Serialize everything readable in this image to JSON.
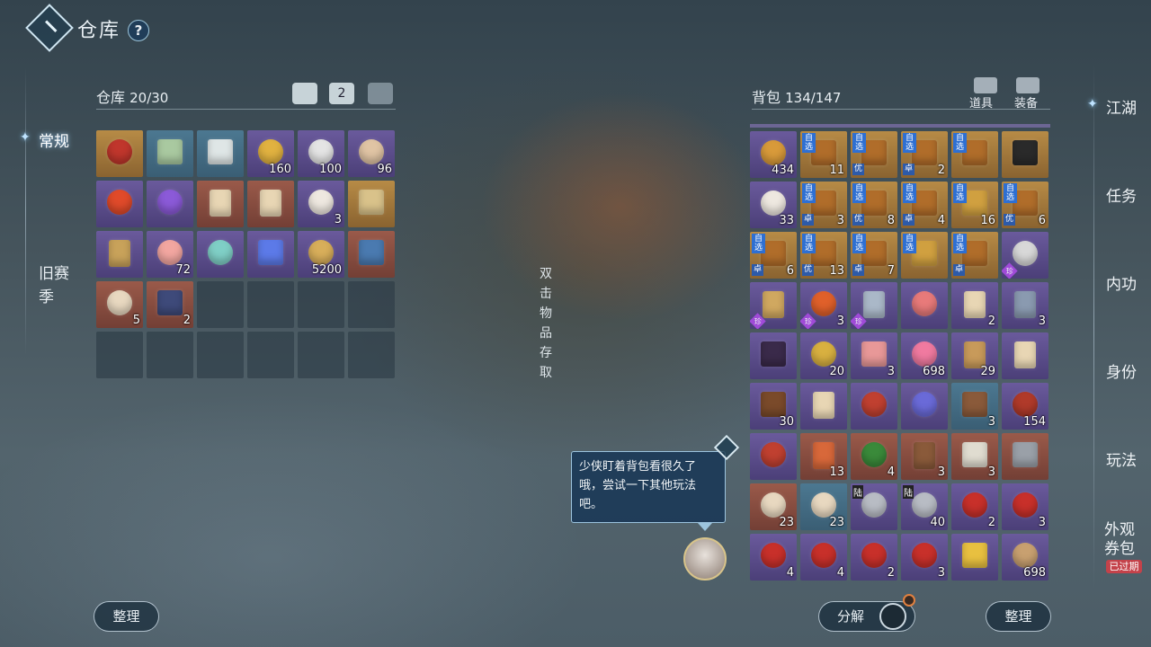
{
  "header": {
    "title": "仓库",
    "help": "?"
  },
  "left_tabs": [
    {
      "label": "常规",
      "active": true
    },
    {
      "label": "旧赛\n季",
      "active": false
    }
  ],
  "warehouse": {
    "label": "仓库",
    "count": "20/30",
    "sort_label": "整理",
    "tab2_number": "2"
  },
  "hint_vertical": "双击物品存取",
  "bag": {
    "label": "背包",
    "count": "134/147",
    "filter_prop": "道具",
    "filter_equip": "装备",
    "decompose_label": "分解",
    "sort_label": "整理"
  },
  "tip": "少侠盯着背包看很久了哦，尝试一下其他玩法吧。",
  "right_tabs": [
    "江湖",
    "任务",
    "内功",
    "身份",
    "玩法",
    "外观\n券包"
  ],
  "expired_badge": "已过期",
  "warehouse_items": [
    {
      "icon": "red-lantern-icon",
      "q": "gold",
      "color": "#c0362c",
      "shape": "round",
      "count": ""
    },
    {
      "icon": "jade-teapot-icon",
      "q": "blue",
      "color": "#a9c9a0",
      "shape": "box",
      "count": ""
    },
    {
      "icon": "porcelain-vase-icon",
      "q": "blue",
      "color": "#dfe6e6",
      "shape": "box",
      "count": ""
    },
    {
      "icon": "gold-coin-icon",
      "q": "purple",
      "color": "#e1b240",
      "shape": "round",
      "count": "160"
    },
    {
      "icon": "silver-ingot-icon",
      "q": "purple",
      "color": "#e4e4e4",
      "shape": "round",
      "count": "100"
    },
    {
      "icon": "pig-mask-icon",
      "q": "purple",
      "color": "#e0c4a4",
      "shape": "round",
      "count": "96"
    },
    {
      "icon": "fire-orb-icon",
      "q": "purple",
      "color": "#e04a2a",
      "shape": "round",
      "count": ""
    },
    {
      "icon": "purple-spirit-icon",
      "q": "purple",
      "color": "#8b5ad8",
      "shape": "round",
      "count": ""
    },
    {
      "icon": "scroll-icon",
      "q": "red",
      "color": "#e8d6b4",
      "shape": "scroll",
      "count": ""
    },
    {
      "icon": "scroll-icon",
      "q": "red",
      "color": "#e8d6b4",
      "shape": "scroll",
      "count": ""
    },
    {
      "icon": "gourd-icon",
      "q": "purple",
      "color": "#eee8e0",
      "shape": "round",
      "count": "3"
    },
    {
      "icon": "letter-icon",
      "q": "gold",
      "color": "#d9c28a",
      "shape": "box",
      "count": ""
    },
    {
      "icon": "bamboo-scroll-icon",
      "q": "purple",
      "color": "#c8a25a",
      "shape": "scroll",
      "count": ""
    },
    {
      "icon": "pink-star-icon",
      "q": "purple",
      "color": "#f2a6a0",
      "shape": "round",
      "count": "72"
    },
    {
      "icon": "jade-hook-icon",
      "q": "purple",
      "color": "#7fcfc6",
      "shape": "round",
      "count": ""
    },
    {
      "icon": "ticket-icon",
      "q": "purple",
      "color": "#5c7ae8",
      "shape": "box",
      "count": ""
    },
    {
      "icon": "golden-figure-icon",
      "q": "purple",
      "color": "#d8ae5a",
      "shape": "round",
      "count": "5200"
    },
    {
      "icon": "jar-icon",
      "q": "red",
      "color": "#4a7ab0",
      "shape": "box",
      "count": ""
    },
    {
      "icon": "rice-bowl-icon",
      "q": "red",
      "color": "#e8d8c0",
      "shape": "round",
      "count": "5"
    },
    {
      "icon": "book-icon",
      "q": "red",
      "color": "#3e4a7a",
      "shape": "box",
      "count": "2"
    }
  ],
  "bag_items": [
    {
      "icon": "gold-leaf-icon",
      "q": "purple",
      "color": "#d89a3a",
      "shape": "round",
      "count": "434"
    },
    {
      "icon": "chest-icon",
      "q": "gold",
      "color": "#b06d2a",
      "shape": "box",
      "count": "11",
      "tag": "自选"
    },
    {
      "icon": "chest-icon",
      "q": "gold",
      "color": "#b06d2a",
      "shape": "box",
      "count": "",
      "tag": "自选",
      "tag2": "优"
    },
    {
      "icon": "chest-icon",
      "q": "gold",
      "color": "#b06d2a",
      "shape": "box",
      "count": "2",
      "tag": "自选",
      "tag2": "卓"
    },
    {
      "icon": "chest-icon",
      "q": "gold",
      "color": "#b06d2a",
      "shape": "box",
      "count": "",
      "tag": "自选"
    },
    {
      "icon": "black-chest-icon",
      "q": "gold",
      "color": "#2a2a2a",
      "shape": "box",
      "count": ""
    },
    {
      "icon": "gourd-icon",
      "q": "purple",
      "color": "#eee8e0",
      "shape": "round",
      "count": "33"
    },
    {
      "icon": "chest-icon",
      "q": "gold",
      "color": "#b06d2a",
      "shape": "box",
      "count": "3",
      "tag": "自选",
      "tag2": "卓"
    },
    {
      "icon": "chest-icon",
      "q": "gold",
      "color": "#b06d2a",
      "shape": "box",
      "count": "8",
      "tag": "自选",
      "tag2": "优"
    },
    {
      "icon": "chest-icon",
      "q": "gold",
      "color": "#b06d2a",
      "shape": "box",
      "count": "4",
      "tag": "自选",
      "tag2": "卓"
    },
    {
      "icon": "chest-icon",
      "q": "gold",
      "color": "#d0a040",
      "shape": "box",
      "count": "16",
      "tag": "自选"
    },
    {
      "icon": "chest-icon",
      "q": "gold",
      "color": "#b06d2a",
      "shape": "box",
      "count": "6",
      "tag": "自选",
      "tag2": "优"
    },
    {
      "icon": "chest-icon",
      "q": "gold",
      "color": "#b06d2a",
      "shape": "box",
      "count": "6",
      "tag": "自选",
      "tag2": "卓"
    },
    {
      "icon": "chest-icon",
      "q": "gold",
      "color": "#b06d2a",
      "shape": "box",
      "count": "13",
      "tag": "自选",
      "tag2": "优"
    },
    {
      "icon": "chest-icon",
      "q": "gold",
      "color": "#b06d2a",
      "shape": "box",
      "count": "7",
      "tag": "自选",
      "tag2": "卓"
    },
    {
      "icon": "chest-icon",
      "q": "gold",
      "color": "#d0a040",
      "shape": "box",
      "count": "",
      "tag": "自选"
    },
    {
      "icon": "chest-icon",
      "q": "gold",
      "color": "#b06d2a",
      "shape": "box",
      "count": "",
      "tag": "自选",
      "tag2": "卓"
    },
    {
      "icon": "silver-mask-icon",
      "q": "purple",
      "color": "#d8d8d8",
      "shape": "round",
      "count": "",
      "zhen": "珍"
    },
    {
      "icon": "map-scroll-icon",
      "q": "purple",
      "color": "#d0a860",
      "shape": "scroll",
      "count": "",
      "zhen": "珍"
    },
    {
      "icon": "flame-icon",
      "q": "purple",
      "color": "#e0602a",
      "shape": "round",
      "count": "3",
      "zhen": "珍"
    },
    {
      "icon": "sword-icon",
      "q": "purple",
      "color": "#aab8c8",
      "shape": "scroll",
      "count": "",
      "zhen": "珍"
    },
    {
      "icon": "crystal-ball-icon",
      "q": "purple",
      "color": "#e87a7a",
      "shape": "round",
      "count": ""
    },
    {
      "icon": "scroll-icon",
      "q": "purple",
      "color": "#e8d6b4",
      "shape": "scroll",
      "count": "2"
    },
    {
      "icon": "spear-icon",
      "q": "purple",
      "color": "#8a9ab0",
      "shape": "scroll",
      "count": "3"
    },
    {
      "icon": "dark-chest-icon",
      "q": "purple",
      "color": "#3a2a4a",
      "shape": "box",
      "count": ""
    },
    {
      "icon": "gold-medal-icon",
      "q": "purple",
      "color": "#d8b040",
      "shape": "round",
      "count": "20"
    },
    {
      "icon": "red-envelope-icon",
      "q": "purple",
      "color": "#e89898",
      "shape": "box",
      "count": "3"
    },
    {
      "icon": "pink-orb-icon",
      "q": "purple",
      "color": "#f07aa0",
      "shape": "round",
      "count": "698"
    },
    {
      "icon": "pendant-icon",
      "q": "purple",
      "color": "#c89a5a",
      "shape": "scroll",
      "count": "29"
    },
    {
      "icon": "scroll-icon",
      "q": "purple",
      "color": "#e8d6b4",
      "shape": "scroll",
      "count": ""
    },
    {
      "icon": "treasure-chest-icon",
      "q": "purple",
      "color": "#7a4a2a",
      "shape": "box",
      "count": "30"
    },
    {
      "icon": "scroll-icon",
      "q": "purple",
      "color": "#e8d6b4",
      "shape": "scroll",
      "count": ""
    },
    {
      "icon": "lucky-bag-icon",
      "q": "purple",
      "color": "#c04030",
      "shape": "round",
      "count": ""
    },
    {
      "icon": "mystic-orb-icon",
      "q": "purple",
      "color": "#6a6ad8",
      "shape": "round",
      "count": ""
    },
    {
      "icon": "arrows-bundle-icon",
      "q": "blue",
      "color": "#8a5a3a",
      "shape": "box",
      "count": "3"
    },
    {
      "icon": "lantern-bag-icon",
      "q": "purple",
      "color": "#b03a2a",
      "shape": "round",
      "count": "154"
    },
    {
      "icon": "lucky-bag-icon",
      "q": "purple",
      "color": "#c04030",
      "shape": "round",
      "count": ""
    },
    {
      "icon": "talisman-icon",
      "q": "red",
      "color": "#d8683a",
      "shape": "scroll",
      "count": "13"
    },
    {
      "icon": "holly-icon",
      "q": "red",
      "color": "#3a8a3a",
      "shape": "round",
      "count": "4"
    },
    {
      "icon": "wooden-staff-icon",
      "q": "red",
      "color": "#8a5a3a",
      "shape": "scroll",
      "count": "3"
    },
    {
      "icon": "dice-icon",
      "q": "red",
      "color": "#e0dcd0",
      "shape": "box",
      "count": "3"
    },
    {
      "icon": "armor-icon",
      "q": "red",
      "color": "#9aa0a8",
      "shape": "box",
      "count": ""
    },
    {
      "icon": "rice-bowl-icon",
      "q": "red",
      "color": "#e8d8c0",
      "shape": "round",
      "count": "23"
    },
    {
      "icon": "rice-bowl-icon",
      "q": "blue",
      "color": "#e8d8c0",
      "shape": "round",
      "count": "23"
    },
    {
      "icon": "helmet-icon",
      "q": "purple",
      "color": "#b8bcc4",
      "shape": "round",
      "count": "",
      "tagz": "陆"
    },
    {
      "icon": "helmet-icon",
      "q": "purple",
      "color": "#b8bcc4",
      "shape": "round",
      "count": "40",
      "tagz": "陆"
    },
    {
      "icon": "red-pouch-icon",
      "q": "purple",
      "color": "#c8302a",
      "shape": "round",
      "count": "2"
    },
    {
      "icon": "red-pouch-icon",
      "q": "purple",
      "color": "#c8302a",
      "shape": "round",
      "count": "3"
    },
    {
      "icon": "red-pouch-icon",
      "q": "purple",
      "color": "#c8302a",
      "shape": "round",
      "count": "4"
    },
    {
      "icon": "red-pouch-icon",
      "q": "purple",
      "color": "#c8302a",
      "shape": "round",
      "count": "4"
    },
    {
      "icon": "red-pouch-icon",
      "q": "purple",
      "color": "#c8302a",
      "shape": "round",
      "count": "2"
    },
    {
      "icon": "red-pouch-icon",
      "q": "purple",
      "color": "#c8302a",
      "shape": "round",
      "count": "3"
    },
    {
      "icon": "color-cards-icon",
      "q": "purple",
      "color": "#e8c040",
      "shape": "box",
      "count": ""
    },
    {
      "icon": "bronze-medal-icon",
      "q": "purple",
      "color": "#c8a070",
      "shape": "round",
      "count": "698"
    }
  ]
}
